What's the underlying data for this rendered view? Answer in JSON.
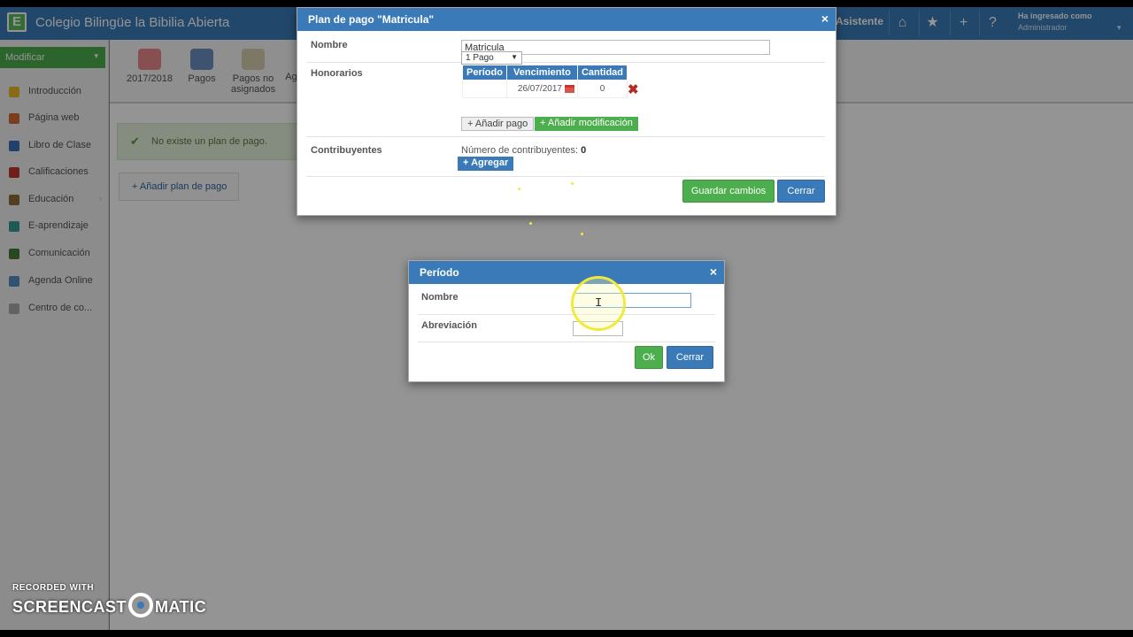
{
  "app": {
    "logo_letter": "E",
    "title": "Colegio Bilingüe la Bibilia Abierta",
    "asistente": "Asistente",
    "user_label": "Ha ingresado como",
    "user_name": "Administrador",
    "topbar_icons": [
      "home-icon",
      "star-icon",
      "plus-icon",
      "help-icon"
    ],
    "accent_color": "#3a7ab8",
    "green_color": "#4cae4c"
  },
  "sidebar": {
    "modify_label": "Modificar",
    "items": [
      {
        "label": "Introducción",
        "icon": "star-icon",
        "color": "#e7b92b"
      },
      {
        "label": "Página web",
        "icon": "web-icon",
        "color": "#d46a3a"
      },
      {
        "label": "Libro de Clase",
        "icon": "book-icon",
        "color": "#3a6fb8"
      },
      {
        "label": "Calificaciones",
        "icon": "grades-icon",
        "color": "#c0392b"
      },
      {
        "label": "Educación",
        "icon": "education-icon",
        "color": "#8a6d3b"
      },
      {
        "label": "E-aprendizaje",
        "icon": "elearning-icon",
        "color": "#3a9a8a"
      },
      {
        "label": "Comunicación",
        "icon": "communication-icon",
        "color": "#4a7a3a"
      },
      {
        "label": "Agenda Online",
        "icon": "agenda-icon",
        "color": "#5a8ac9"
      },
      {
        "label": "Centro de co...",
        "icon": "center-icon",
        "color": "#aaaaaa"
      }
    ]
  },
  "toolbar": {
    "items": [
      {
        "label": "2017/2018",
        "icon": "calendar-icon"
      },
      {
        "label": "Pagos",
        "icon": "coins-icon"
      },
      {
        "label": "Pagos no asignados",
        "icon": "unassigned-payments-icon"
      },
      {
        "label": "Ag",
        "icon": "generic-icon"
      }
    ]
  },
  "content": {
    "notice": "No existe un plan de pago.",
    "add_plan": "+ Añadir plan de pago"
  },
  "plan_dialog": {
    "title": "Plan de pago \"Matricula\"",
    "close": "×",
    "nombre_label": "Nombre",
    "nombre_value": "Matricula",
    "honorarios_label": "Honorarios",
    "pagos_select": "1 Pago",
    "table_headers": [
      "Período",
      "Vencimiento",
      "Cantidad"
    ],
    "table_row": {
      "periodo": "",
      "vencimiento": "26/07/2017",
      "cantidad": "0"
    },
    "add_payment": "+ Añadir pago",
    "add_modification": "+ Añadir modificación",
    "contribuyentes_label": "Contribuyentes",
    "contrib_count_label": "Número de contribuyentes:",
    "contrib_count": "0",
    "agregar": "+ Agregar",
    "save": "Guardar cambios",
    "cancel": "Cerrar"
  },
  "periodo_dialog": {
    "title": "Período",
    "close": "×",
    "nombre_label": "Nombre",
    "nombre_value": "",
    "abreviacion_label": "Abreviación",
    "abreviacion_value": "",
    "ok": "Ok",
    "cancel": "Cerrar"
  },
  "watermark": {
    "line1": "RECORDED WITH",
    "brand_left": "SCREENCAST",
    "brand_right": "MATIC"
  }
}
